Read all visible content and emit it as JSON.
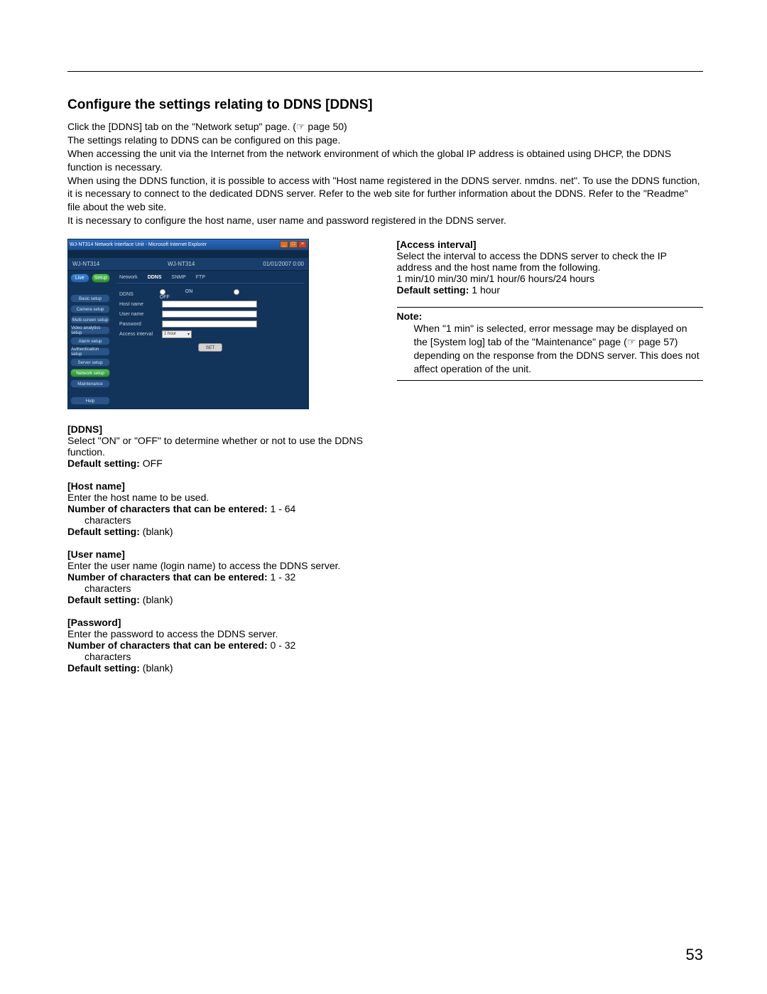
{
  "heading": "Configure the settings relating to DDNS [DDNS]",
  "intro": [
    "Click the [DDNS] tab on the \"Network setup\" page. (☞ page 50)",
    "The settings relating to DDNS can be configured on this page.",
    "When accessing the unit via the Internet from the network environment of which the global IP address is obtained using DHCP, the DDNS function is necessary.",
    "When using the DDNS function, it is possible to access with \"Host name registered in the DDNS server. nmdns. net\". To use the DDNS function, it is necessary to connect to the dedicated DDNS server. Refer to the web site for further information about the DDNS. Refer to the \"Readme\" file about the web site.",
    "It is necessary to configure the host name, user name and password registered in the DDNS server."
  ],
  "screenshot": {
    "titlebar": "WJ-NT314 Network Interface Unit - Microsoft Internet Explorer",
    "brand_left": "WJ-NT314",
    "brand_right": "WJ-NT314",
    "datetime": "01/01/2007 0:00",
    "top_buttons": {
      "live": "Live",
      "setup": "Setup"
    },
    "sidebar": [
      "Basic setup",
      "Camera setup",
      "Multi-screen setup",
      "Video analytics setup",
      "Alarm setup",
      "Authentication setup",
      "Server setup",
      "Network setup",
      "Maintenance",
      "Help"
    ],
    "sidebar_selected_index": 7,
    "tabs": [
      "Network",
      "DDNS",
      "SNMP",
      "FTP"
    ],
    "selected_tab_index": 1,
    "form": {
      "ddns_label": "DDNS",
      "ddns_on": "ON",
      "ddns_off": "OFF",
      "host_label": "Host name",
      "user_label": "User name",
      "pw_label": "Password",
      "interval_label": "Access interval",
      "interval_value": "1 hour",
      "set_button": "SET"
    }
  },
  "left_sections": {
    "ddns": {
      "head": "[DDNS]",
      "body": "Select \"ON\" or \"OFF\" to determine whether or not to use the DDNS function.",
      "def_label": "Default setting:",
      "def_val": " OFF"
    },
    "host": {
      "head": "[Host name]",
      "body": "Enter the host name to be used.",
      "num_label": "Number of characters that can be entered:",
      "num_val": " 1 - 64",
      "num_unit": "characters",
      "def_label": "Default setting:",
      "def_val": " (blank)"
    },
    "user": {
      "head": "[User name]",
      "body": "Enter the user name (login name) to access the DDNS server.",
      "num_label": "Number of characters that can be entered:",
      "num_val": " 1 - 32",
      "num_unit": "characters",
      "def_label": "Default setting:",
      "def_val": " (blank)"
    },
    "pw": {
      "head": "[Password]",
      "body": "Enter the password to access the DDNS server.",
      "num_label": "Number of characters that can be entered:",
      "num_val": " 0 - 32",
      "num_unit": "characters",
      "def_label": "Default setting:",
      "def_val": " (blank)"
    }
  },
  "right_sections": {
    "interval": {
      "head": "[Access interval]",
      "body1": "Select the interval to access the DDNS server to check the IP address and the host name from the following.",
      "body2": "1 min/10 min/30 min/1 hour/6 hours/24 hours",
      "def_label": "Default setting:",
      "def_val": " 1 hour"
    },
    "note": {
      "head": "Note:",
      "body": "When \"1 min\" is selected, error message may be displayed on the [System log] tab of the \"Maintenance\" page (☞ page 57) depending on the response from the DDNS server. This does not affect operation of the unit."
    }
  },
  "page_number": "53"
}
